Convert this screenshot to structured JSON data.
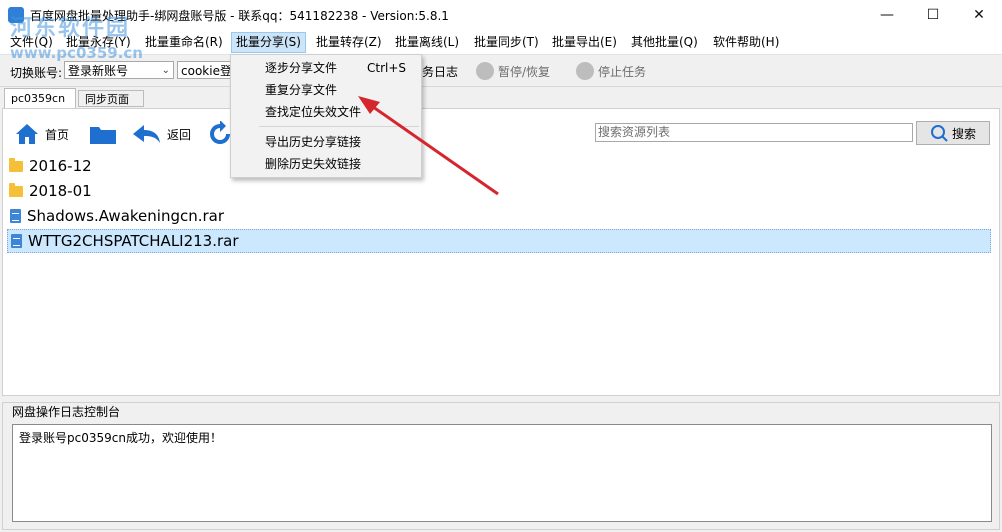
{
  "window": {
    "title": "百度网盘批量处理助手-绑网盘账号版 - 联系qq：541182238 - Version:5.8.1",
    "controls": {
      "minimize": "—",
      "maximize": "☐",
      "close": "✕"
    }
  },
  "menubar": {
    "items": [
      {
        "label": "文件(Q)"
      },
      {
        "label": "批量永存(Y)"
      },
      {
        "label": "批量重命名(R)"
      },
      {
        "label": "批量分享(S)"
      },
      {
        "label": "批量转存(Z)"
      },
      {
        "label": "批量离线(L)"
      },
      {
        "label": "批量同步(T)"
      },
      {
        "label": "批量导出(E)"
      },
      {
        "label": "其他批量(Q)"
      },
      {
        "label": "软件帮助(H)"
      }
    ]
  },
  "toolbar": {
    "account_label": "切换账号:",
    "account_value": "登录新账号",
    "cookie_value": "cookie登",
    "log_label": "务日志",
    "pause_label": "暂停/恢复",
    "stop_label": "停止任务"
  },
  "tabs": [
    {
      "label": "pc0359cn"
    },
    {
      "label": "同步页面"
    }
  ],
  "nav": {
    "home_label": "首页",
    "back_label": "返回",
    "search_placeholder": "搜索资源列表",
    "search_button": "搜索"
  },
  "files": [
    {
      "name": "2016-12",
      "type": "folder"
    },
    {
      "name": "2018-01",
      "type": "folder"
    },
    {
      "name": "Shadows.Awakeningcn.rar",
      "type": "file"
    },
    {
      "name": "WTTG2CHSPATCHALI213.rar",
      "type": "file",
      "selected": true
    }
  ],
  "dropdown": {
    "items": [
      {
        "label": "逐步分享文件",
        "shortcut": "Ctrl+S"
      },
      {
        "label": "重复分享文件",
        "shortcut": ""
      },
      {
        "label": "查找定位失效文件",
        "shortcut": ""
      },
      {
        "label": "导出历史分享链接",
        "shortcut": ""
      },
      {
        "label": "删除历史失效链接",
        "shortcut": ""
      }
    ]
  },
  "log": {
    "title": "网盘操作日志控制台",
    "message": "登录账号pc0359cn成功，欢迎使用！"
  },
  "watermark": {
    "text_cn": "河东软件园",
    "text_url": "www.pc0359.cn"
  },
  "colors": {
    "accent": "#cce4f7",
    "selection": "#cce8ff",
    "arrow": "#d6262d",
    "icon_blue": "#2f7fd6",
    "folder": "#f5c038"
  }
}
